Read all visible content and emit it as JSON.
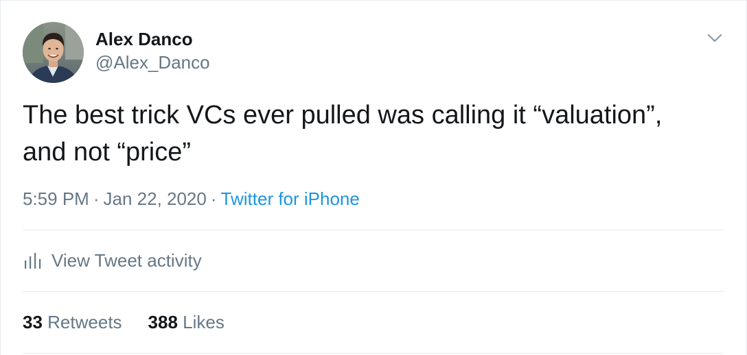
{
  "tweet": {
    "author": {
      "display_name": "Alex Danco",
      "handle": "@Alex_Danco",
      "avatar_icon": "profile-photo"
    },
    "text_line1": "The best trick VCs ever pulled was calling it “valuation”,",
    "text_line2": "and not “price”",
    "time": "5:59 PM",
    "separator": "·",
    "date": "Jan 22, 2020",
    "source": "Twitter for iPhone",
    "activity_label": "View Tweet activity",
    "activity_icon": "bar-chart-icon",
    "menu_icon": "chevron-down-icon",
    "stats": {
      "retweets_count": "33",
      "retweets_label": "Retweets",
      "likes_count": "388",
      "likes_label": "Likes"
    }
  },
  "colors": {
    "text_primary": "#14171a",
    "text_secondary": "#657786",
    "link": "#1b95e0",
    "divider": "#e6ecf0"
  }
}
